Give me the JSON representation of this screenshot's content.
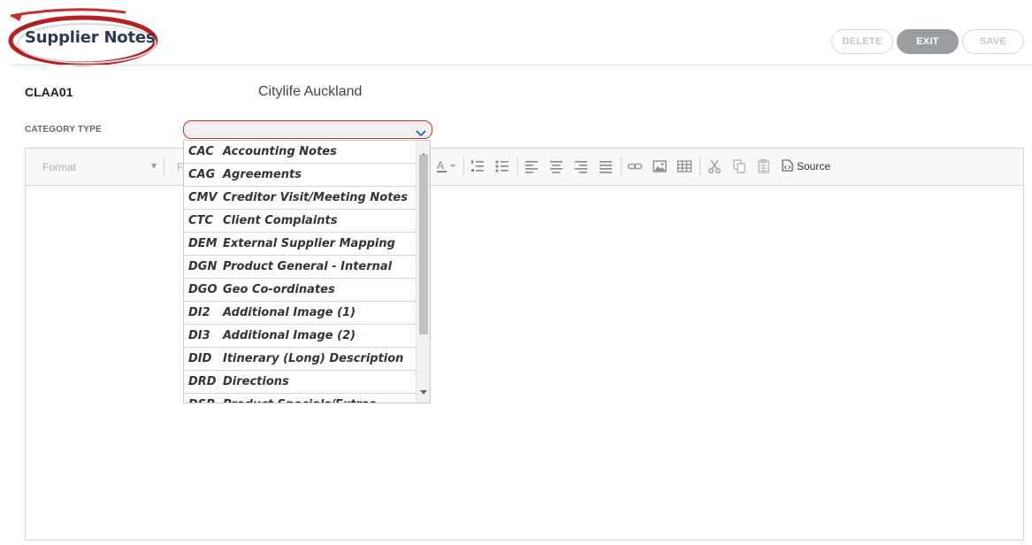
{
  "header": {
    "title": "Supplier Notes",
    "buttons": {
      "delete": "DELETE",
      "exit": "EXIT",
      "save": "SAVE"
    }
  },
  "supplier": {
    "code": "CLAA01",
    "name": "Citylife Auckland"
  },
  "category": {
    "label": "CATEGORY TYPE",
    "selected": "",
    "options": [
      {
        "code": "CAC",
        "desc": "Accounting Notes"
      },
      {
        "code": "CAG",
        "desc": "Agreements"
      },
      {
        "code": "CMV",
        "desc": "Creditor Visit/Meeting Notes"
      },
      {
        "code": "CTC",
        "desc": "Client Complaints"
      },
      {
        "code": "DEM",
        "desc": "External Supplier Mapping"
      },
      {
        "code": "DGN",
        "desc": "Product General - Internal"
      },
      {
        "code": "DGO",
        "desc": "Geo Co-ordinates"
      },
      {
        "code": "DI2",
        "desc": "Additional Image (1)"
      },
      {
        "code": "DI3",
        "desc": "Additional Image (2)"
      },
      {
        "code": "DID",
        "desc": "Itinerary (Long) Description"
      },
      {
        "code": "DRD",
        "desc": "Directions"
      },
      {
        "code": "DSP",
        "desc": "Product Specials/Extras"
      }
    ]
  },
  "editor": {
    "format_placeholder": "Format",
    "font_placeholder": "F",
    "source_label": "Source"
  },
  "colors": {
    "accent_red": "#c62f2f",
    "title_navy": "#2b3a52",
    "exit_grey": "#9a9ea3"
  }
}
